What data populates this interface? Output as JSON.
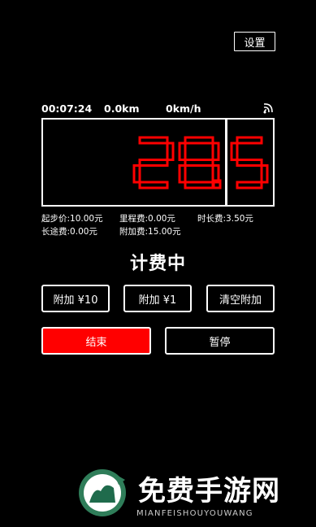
{
  "header": {
    "settings_label": "设置"
  },
  "status": {
    "time": "00:07:24",
    "distance": "0.0km",
    "speed": "0km/h",
    "signal_icon": "signal-icon"
  },
  "meter": {
    "display_value": "28.5",
    "digit_color": "#ff0000"
  },
  "fees": {
    "base_label": "起步价:",
    "base_value": "10.00元",
    "mileage_label": "里程费:",
    "mileage_value": "0.00元",
    "time_label": "时长费:",
    "time_value": "3.50元",
    "long_label": "长途费:",
    "long_value": "0.00元",
    "extra_label": "附加费:",
    "extra_value": "15.00元"
  },
  "state_title": "计费中",
  "buttons": {
    "add10": "附加 ¥10",
    "add1": "附加 ¥1",
    "clear_extra": "清空附加",
    "end": "结束",
    "pause": "暂停"
  },
  "watermark": {
    "text": "免费手游网",
    "sub": "MIANFEISHOUYOUWANG"
  },
  "colors": {
    "accent": "#ff0000",
    "background": "#000000",
    "foreground": "#ffffff"
  }
}
